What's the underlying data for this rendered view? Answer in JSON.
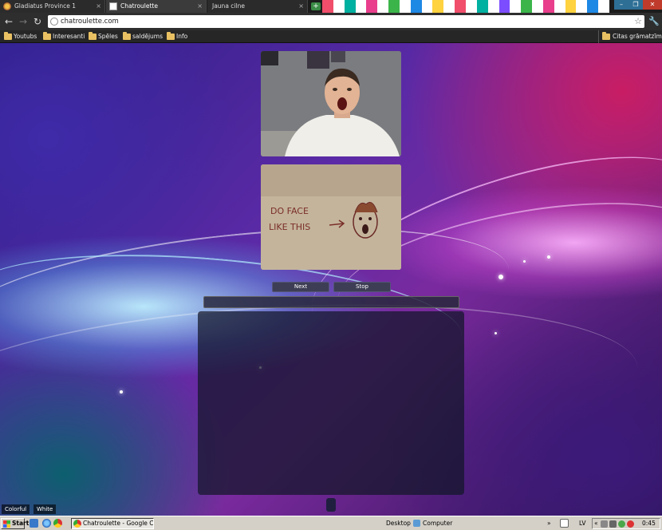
{
  "browser": {
    "tabs": [
      {
        "title": "Gladiatus Province 1",
        "close": "×"
      },
      {
        "title": "Chatroulette",
        "close": "×"
      },
      {
        "title": "Jauna cilne",
        "close": "×"
      }
    ],
    "new_tab": "+",
    "window_buttons": {
      "minimize": "–",
      "maximize": "❐",
      "close": "✕"
    },
    "nav": {
      "back": "←",
      "forward": "→",
      "reload": "↻"
    },
    "address": "chatroulette.com",
    "star": "☆",
    "wrench": "🔧",
    "stripe_colors": [
      "#f04e6b",
      "#ffffff",
      "#00b0a0",
      "#ffffff",
      "#e83e8c",
      "#ffffff",
      "#3bb54a",
      "#ffffff",
      "#1e88e5",
      "#ffffff",
      "#ffd23f",
      "#ffffff",
      "#f04e6b",
      "#ffffff",
      "#00b0a0",
      "#ffffff",
      "#7c4dff",
      "#ffffff",
      "#3bb54a",
      "#ffffff",
      "#e83e8c",
      "#ffffff",
      "#ffd23f",
      "#ffffff",
      "#1e88e5",
      "#ffffff"
    ]
  },
  "bookmarks": {
    "items": [
      "Youtubs",
      "Interesanti",
      "Spēles",
      "saldējums",
      "Info"
    ],
    "other": "Citas grāmatzīmes"
  },
  "page": {
    "next_label": "Next",
    "stop_label": "Stop",
    "chat_input_value": "",
    "themes": [
      "Colorful",
      "White"
    ],
    "sign_text_line1": "DO FACE",
    "sign_text_line2": "LIKE THIS"
  },
  "taskbar": {
    "start_label": "Start",
    "task_label": "Chatroulette - Google C...",
    "desktop_label": "Desktop",
    "computer_label": "Computer",
    "chevrons": "»",
    "lang": "LV",
    "tray_chevron": "«",
    "clock": "0:45"
  }
}
